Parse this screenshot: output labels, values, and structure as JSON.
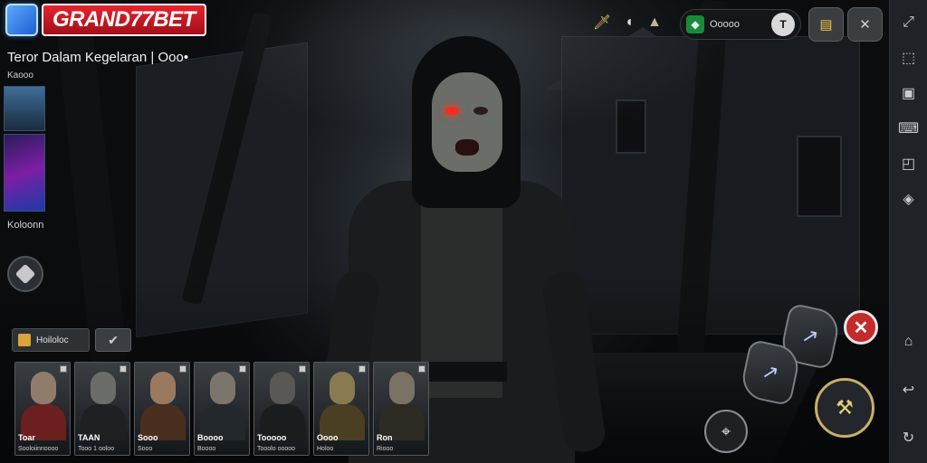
{
  "branding": {
    "logo_text": "GRAND77BET",
    "game_title": "Teror Dalam Kegelaran | Ooo•",
    "game_subtitle": "Kaooo",
    "thumb_label": "Koloonn"
  },
  "top_hud": {
    "icons": [
      "dagger-icon",
      "sound-icon",
      "helmet-icon"
    ],
    "currency_value": "Ooooo",
    "currency_add_label": "T",
    "pill_left": "gold-icon",
    "pill_right": "mute-icon"
  },
  "filters": {
    "filter_label": "Hoiloloc",
    "check_symbol": "✔"
  },
  "roster": [
    {
      "name": "Toar",
      "role": "Sooloiinnoooo",
      "face": "#8f7c6b",
      "body": "#6b1f1f"
    },
    {
      "name": "TAAN",
      "role": "Tooo 1 ooloo",
      "face": "#6b6d68",
      "body": "#1e2022"
    },
    {
      "name": "Sooo",
      "role": "Sooo",
      "face": "#9a7a5e",
      "body": "#4a2e1f"
    },
    {
      "name": "Boooo",
      "role": "Boooo",
      "face": "#7b756c",
      "body": "#23282d"
    },
    {
      "name": "Tooooo",
      "role": "Tooolo ooooo",
      "face": "#5a5855",
      "body": "#1b1c1e"
    },
    {
      "name": "Oooo",
      "role": "Holoo",
      "face": "#8a7a52",
      "body": "#4a3f22"
    },
    {
      "name": "Ron",
      "role": "Riooo",
      "face": "#7a7262",
      "body": "#2e2b24"
    }
  ],
  "actions": {
    "close_symbol": "✕",
    "skill_a_symbol": "↗",
    "skill_b_symbol": "↗",
    "melee_symbol": "⚒",
    "target_symbol": "⌖"
  },
  "sidebar_icons": [
    {
      "name": "expand-icon",
      "glyph": "⤢"
    },
    {
      "name": "select-area-icon",
      "glyph": "⬚"
    },
    {
      "name": "screenshot-icon",
      "glyph": "▣"
    },
    {
      "name": "keyboard-icon",
      "glyph": "⌨"
    },
    {
      "name": "rotate-icon",
      "glyph": "◰"
    },
    {
      "name": "location-icon",
      "glyph": "◈"
    },
    {
      "name": "home-icon",
      "glyph": "⌂"
    },
    {
      "name": "back-icon",
      "glyph": "↩"
    },
    {
      "name": "recent-icon",
      "glyph": "↻"
    }
  ]
}
